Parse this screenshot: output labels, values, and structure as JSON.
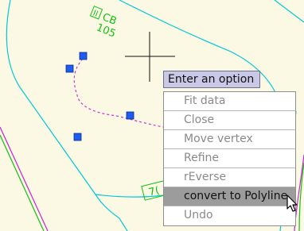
{
  "canvas": {
    "background": "#fbf8e4",
    "labels": {
      "cb_label": "CB",
      "cb_number": "105",
      "cb_box_text": "II",
      "tag_partial": "7("
    },
    "colors": {
      "boundary_line": "#00c8d8",
      "road_line_magenta": "#d020d0",
      "road_line_green": "#12c012",
      "dashed_curve": "#d030d0",
      "grips": "#1e5cf0",
      "crosshair": "#111111"
    }
  },
  "command": {
    "prompt": "Enter an option",
    "options": [
      {
        "label": "Fit data",
        "selected": false
      },
      {
        "label": "Close",
        "selected": false
      },
      {
        "label": "Move vertex",
        "selected": false
      },
      {
        "label": "Refine",
        "selected": false
      },
      {
        "label": "rEverse",
        "selected": false
      },
      {
        "label": "convert to Polyline",
        "selected": true
      },
      {
        "label": "Undo",
        "selected": false
      }
    ]
  },
  "icons": {
    "pointer": "arrow-cursor-icon",
    "crosshair": "crosshair-icon",
    "grip": "grip-square-icon"
  }
}
